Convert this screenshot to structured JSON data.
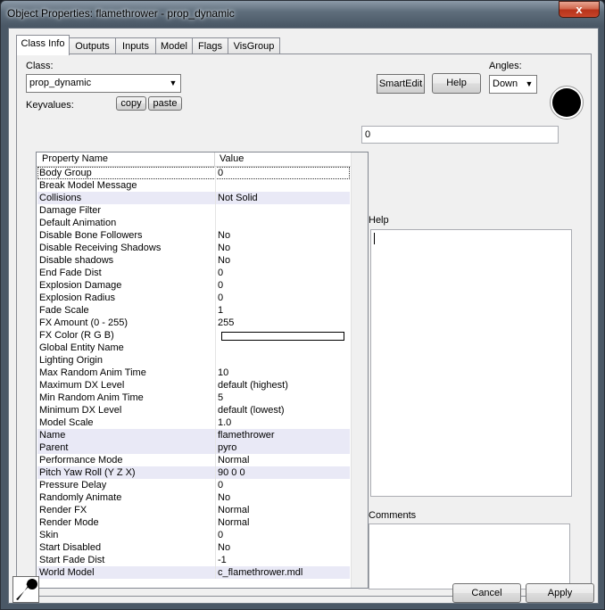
{
  "window": {
    "title": "Object Properties: flamethrower - prop_dynamic",
    "close_glyph": "x"
  },
  "tabs": [
    {
      "label": "Class Info"
    },
    {
      "label": "Outputs"
    },
    {
      "label": "Inputs"
    },
    {
      "label": "Model"
    },
    {
      "label": "Flags"
    },
    {
      "label": "VisGroup"
    }
  ],
  "class": {
    "label": "Class:",
    "value": "prop_dynamic",
    "keyvalues_label": "Keyvalues:",
    "copy_label": "copy",
    "paste_label": "paste"
  },
  "toolbar": {
    "smartedit_label": "SmartEdit",
    "help_label": "Help",
    "angles_label": "Angles:",
    "angles_value": "Down"
  },
  "grid": {
    "col_name": "Property Name",
    "col_value": "Value",
    "rows": [
      {
        "name": "Body Group",
        "value": "0"
      },
      {
        "name": "Break Model Message",
        "value": ""
      },
      {
        "name": "Collisions",
        "value": "Not Solid"
      },
      {
        "name": "Damage Filter",
        "value": ""
      },
      {
        "name": "Default Animation",
        "value": ""
      },
      {
        "name": "Disable Bone Followers",
        "value": "No"
      },
      {
        "name": "Disable Receiving Shadows",
        "value": "No"
      },
      {
        "name": "Disable shadows",
        "value": "No"
      },
      {
        "name": "End Fade Dist",
        "value": "0"
      },
      {
        "name": "Explosion Damage",
        "value": "0"
      },
      {
        "name": "Explosion Radius",
        "value": "0"
      },
      {
        "name": "Fade Scale",
        "value": "1"
      },
      {
        "name": "FX Amount (0 - 255)",
        "value": "255"
      },
      {
        "name": "FX Color (R G B)",
        "value": ""
      },
      {
        "name": "Global Entity Name",
        "value": ""
      },
      {
        "name": "Lighting Origin",
        "value": ""
      },
      {
        "name": "Max Random Anim Time",
        "value": "10"
      },
      {
        "name": "Maximum DX Level",
        "value": "default (highest)"
      },
      {
        "name": "Min Random Anim Time",
        "value": "5"
      },
      {
        "name": "Minimum DX Level",
        "value": "default (lowest)"
      },
      {
        "name": "Model Scale",
        "value": "1.0"
      },
      {
        "name": "Name",
        "value": "flamethrower"
      },
      {
        "name": "Parent",
        "value": "pyro"
      },
      {
        "name": "Performance Mode",
        "value": "Normal"
      },
      {
        "name": "Pitch Yaw Roll (Y Z X)",
        "value": "90 0 0"
      },
      {
        "name": "Pressure Delay",
        "value": "0"
      },
      {
        "name": "Randomly Animate",
        "value": "No"
      },
      {
        "name": "Render FX",
        "value": "Normal"
      },
      {
        "name": "Render Mode",
        "value": "Normal"
      },
      {
        "name": "Skin",
        "value": "0"
      },
      {
        "name": "Start Disabled",
        "value": "No"
      },
      {
        "name": "Start Fade Dist",
        "value": "-1"
      },
      {
        "name": "World Model",
        "value": "c_flamethrower.mdl"
      }
    ]
  },
  "right": {
    "value_field": "0",
    "help_label": "Help",
    "comments_label": "Comments"
  },
  "footer": {
    "cancel_label": "Cancel",
    "apply_label": "Apply"
  }
}
